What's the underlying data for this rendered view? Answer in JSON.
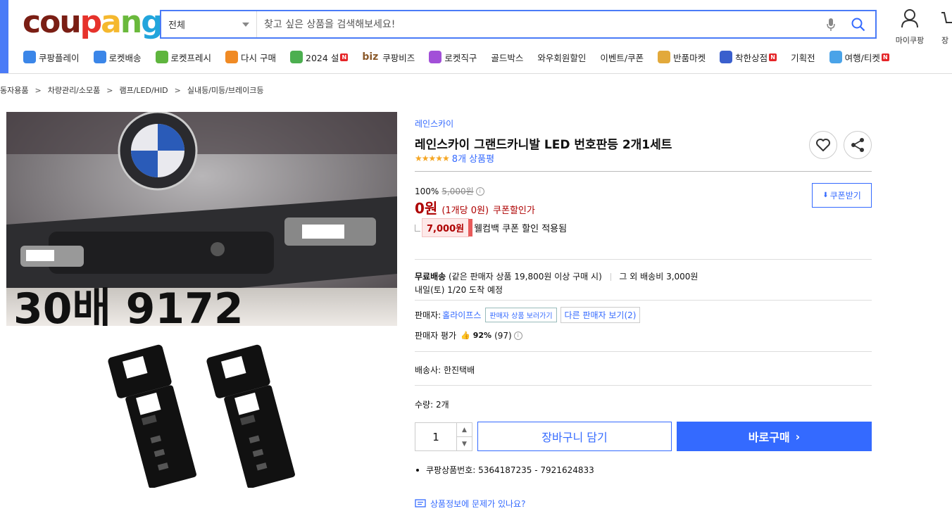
{
  "header": {
    "logo_letters": [
      "c",
      "o",
      "u",
      "p",
      "a",
      "n",
      "g"
    ],
    "logo_colors": [
      "#7a1e14",
      "#7a1e14",
      "#7a1e14",
      "#e6322b",
      "#f5b82e",
      "#6ab93c",
      "#22a5dc"
    ],
    "search": {
      "category": "전체",
      "placeholder": "찾고 싶은 상품을 검색해보세요!"
    },
    "mypage_label": "마이쿠팡",
    "cart_label_cut": "장"
  },
  "nav": [
    {
      "label": "쿠팡플레이",
      "icon": "coupang-play-icon",
      "color": "#3b86e8"
    },
    {
      "label": "로켓배송",
      "icon": "rocket-icon",
      "color": "#3b86e8"
    },
    {
      "label": "로켓프레시",
      "icon": "rocket-fresh-icon",
      "color": "#5fb53e"
    },
    {
      "label": "다시 구매",
      "icon": "rebuy-icon",
      "color": "#f08a24"
    },
    {
      "label": "2024 설",
      "icon": "new-year-icon",
      "color": "#4caf50",
      "badge": "N"
    },
    {
      "label": "쿠팡비즈",
      "icon": "biz-icon",
      "prefix": "biz",
      "color": "#8b5a2b"
    },
    {
      "label": "로켓직구",
      "icon": "global-icon",
      "color": "#a24fd8"
    },
    {
      "label": "골드박스"
    },
    {
      "label": "와우회원할인"
    },
    {
      "label": "이벤트/쿠폰"
    },
    {
      "label": "반품마켓",
      "icon": "return-market-icon",
      "color": "#e2a93b"
    },
    {
      "label": "착한상점",
      "icon": "good-store-icon",
      "color": "#3a5fcd",
      "badge": "N"
    },
    {
      "label": "기획전"
    },
    {
      "label": "여행/티켓",
      "icon": "airplane-icon",
      "color": "#4aa3e8",
      "badge": "N"
    }
  ],
  "breadcrumb": [
    "동자용품",
    "차량관리/소모품",
    "램프/LED/HID",
    "실내등/미등/브레이크등"
  ],
  "product": {
    "brand": "레인스카이",
    "title": "레인스카이 그랜드카니발 LED 번호판등 2개1세트",
    "stars": "★★★★★",
    "review_count": "8개 상품평",
    "discount_rate": "100%",
    "original_price": "5,000원",
    "sale_price": "0원",
    "unit_price": "(1개당 0원)",
    "coupon_price_label": "쿠폰할인가",
    "coupon_button": "쿠폰받기",
    "welcome_amount": "7,000원",
    "welcome_text": "웰컴백 쿠폰 할인 적용됨",
    "shipping_bold": "무료배송",
    "shipping_detail": "(같은 판매자 상품 19,800원 이상 구매 시)",
    "shipping_other": "그 외 배송비 3,000원",
    "arrival": "내일(토) 1/20 도착 예정",
    "seller_label": "판매자:",
    "seller_name": "홀라이프스",
    "seller_products_btn": "판매자 상품 보러가기",
    "other_sellers_btn": "다른 판매자 보기(2)",
    "seller_rating_label": "판매자 평가",
    "seller_rating": "92%",
    "seller_rating_count": "(97)",
    "courier": "배송사: 한진택배",
    "qty_label": "수량: 2개",
    "qty_value": "1",
    "cart_button": "장바구니 담기",
    "buy_button": "바로구매",
    "product_number": "쿠팡상품번호: 5364187235 - 7921624833",
    "report_link": "상품정보에 문제가 있나요?"
  },
  "colors": {
    "accent": "#346aff",
    "price_red": "#ae0000",
    "star": "#f5a623"
  }
}
